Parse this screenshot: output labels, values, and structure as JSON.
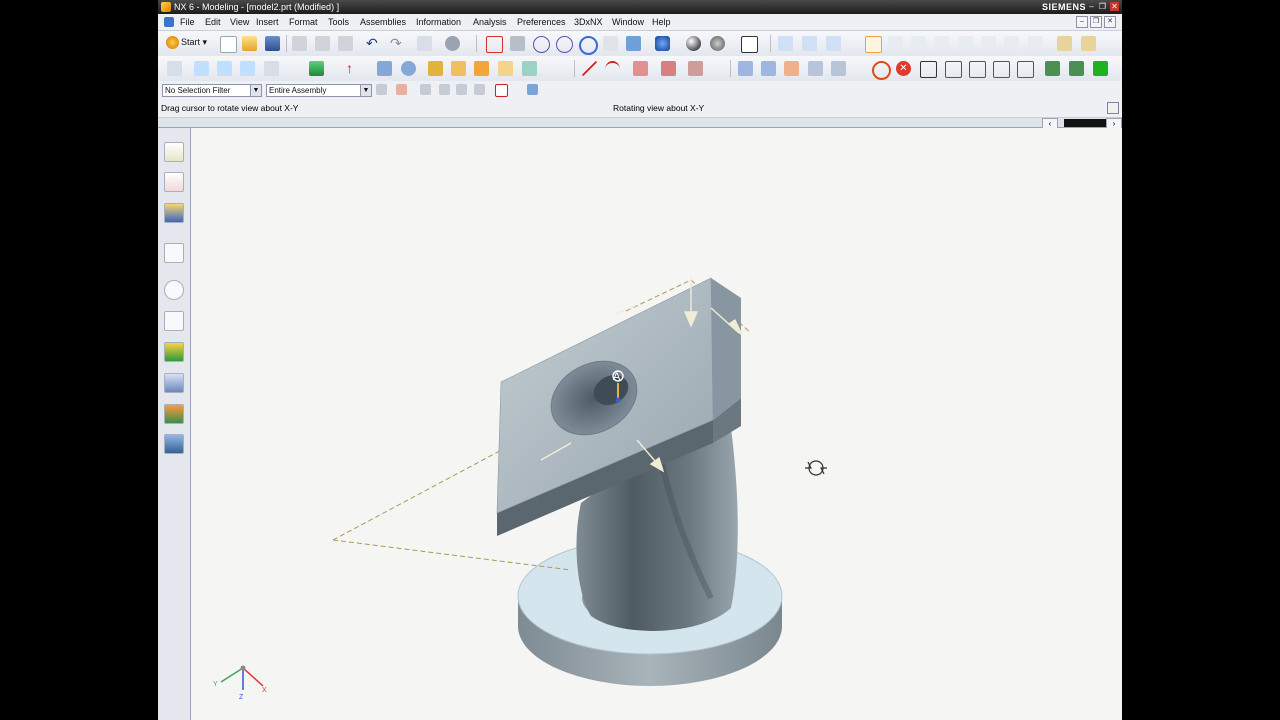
{
  "window": {
    "title": "NX 6 - Modeling - [model2.prt (Modified) ]",
    "brand": "SIEMENS"
  },
  "menu": [
    "File",
    "Edit",
    "View",
    "Insert",
    "Format",
    "Tools",
    "Assemblies",
    "Information",
    "Analysis",
    "Preferences",
    "3DxNX",
    "Window",
    "Help"
  ],
  "toolbar": {
    "start_label": "Start",
    "selection_filter": "No Selection Filter",
    "scope": "Entire Assembly"
  },
  "status": {
    "cue": "Drag cursor to rotate view about X-Y",
    "status": "Rotating view about X-Y"
  },
  "triad": {
    "x": "X",
    "y": "Y",
    "z": "Z"
  },
  "model": {
    "point_label": "A"
  },
  "colors": {
    "titlebar": "#2a2a2a",
    "menubar": "#eef0f4",
    "viewport": "#f5f5f4",
    "part_top": "#b6c0c7",
    "part_side": "#5d6a72",
    "flange_top": "#d6e6ee",
    "datum": "#a89a5a"
  }
}
